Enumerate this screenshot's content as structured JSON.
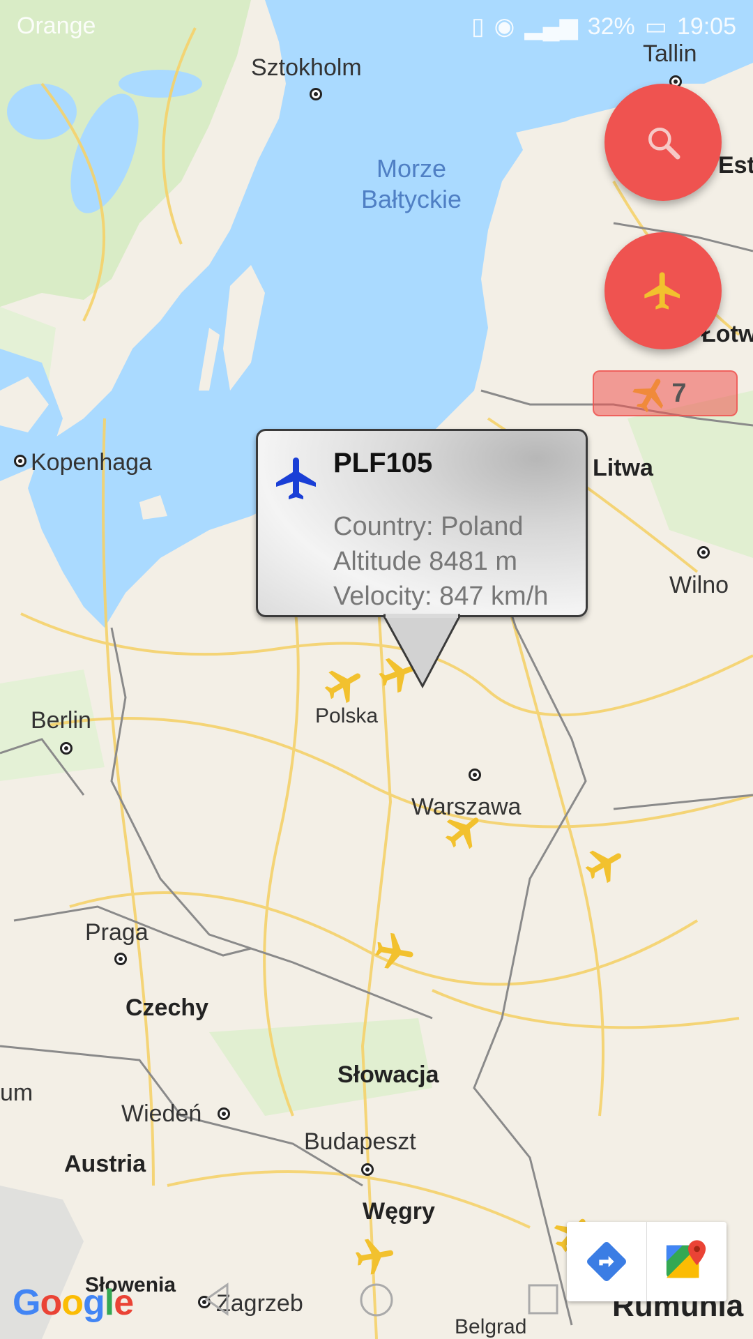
{
  "status_bar": {
    "carrier": "Orange",
    "battery": "32%",
    "time": "19:05"
  },
  "map": {
    "sea_label": "Morze Bałtyckie",
    "cities": [
      "Tallin",
      "Sztokholm",
      "Kopenhaga",
      "Wilno",
      "Berlin",
      "Warszawa",
      "Praga",
      "Wiedeń",
      "Budapeszt",
      "Zagrzeb",
      "Belgrad"
    ],
    "countries": [
      "Łotwa",
      "Litwa",
      "Polska",
      "Czechy",
      "Słowacja",
      "Austria",
      "Węgry",
      "Słowenia",
      "Rumunia",
      "Eston",
      "um"
    ],
    "colors": {
      "water": "#aadaff",
      "land": "#f3efe6",
      "green": "#cfe8bd",
      "roads": "#f7d66c",
      "plane": "#f2c12e"
    }
  },
  "fab_search": {
    "icon": "search-icon"
  },
  "fab_planes": {
    "icon": "airplane-icon"
  },
  "cluster": {
    "count": "7"
  },
  "info_window": {
    "callsign": "PLF105",
    "country": "Country: Poland",
    "altitude": "Altitude 8481 m",
    "velocity": "Velocity: 847 km/h",
    "icon": "airplane-icon",
    "icon_color": "#1a3fd6"
  },
  "map_toolbar": {
    "directions_icon": "directions-icon",
    "maps_icon": "google-maps-icon"
  },
  "attribution": "Google"
}
